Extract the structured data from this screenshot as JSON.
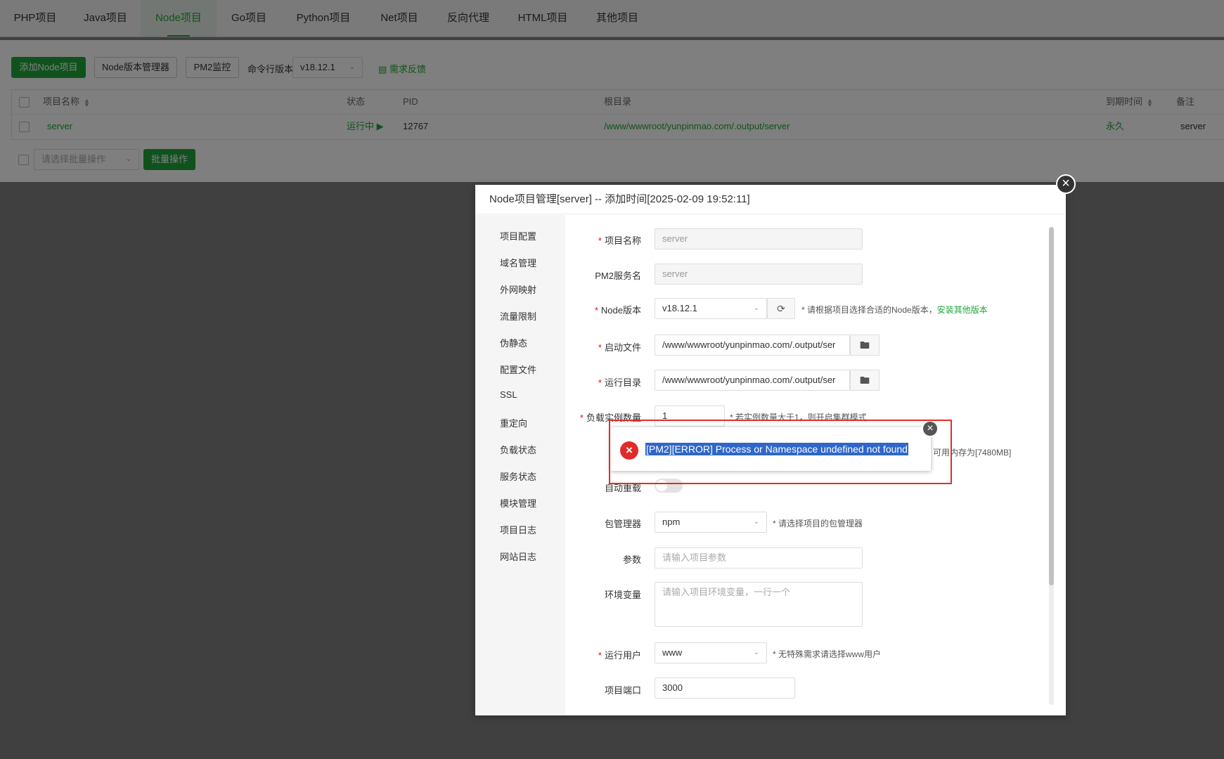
{
  "tabs": [
    "PHP项目",
    "Java项目",
    "Node项目",
    "Go项目",
    "Python项目",
    "Net项目",
    "反向代理",
    "HTML项目",
    "其他项目"
  ],
  "toolbar": {
    "add_label": "添加Node项目",
    "version_mgr_label": "Node版本管理器",
    "pm2_label": "PM2监控",
    "cli_version_label": "命令行版本",
    "cli_version_value": "v18.12.1",
    "feedback_label": "需求反馈"
  },
  "table": {
    "headers": {
      "name": "项目名称",
      "status": "状态",
      "pid": "PID",
      "root": "根目录",
      "expire": "到期时间",
      "note": "备注"
    },
    "row": {
      "name": "server",
      "status": "运行中 ▶",
      "pid": "12767",
      "root": "/www/wwwroot/yunpinmao.com/.output/server",
      "expire": "永久",
      "note": "server"
    }
  },
  "batch": {
    "placeholder": "请选择批量操作",
    "button": "批量操作"
  },
  "dialog": {
    "title": "Node项目管理[server] -- 添加时间[2025-02-09 19:52:11]",
    "sidebar": [
      "项目配置",
      "域名管理",
      "外网映射",
      "流量限制",
      "伪静态",
      "配置文件",
      "SSL",
      "重定向",
      "负载状态",
      "服务状态",
      "模块管理",
      "项目日志",
      "网站日志"
    ],
    "form": {
      "name_label": "项目名称",
      "name_value": "server",
      "pm2_label": "PM2服务名",
      "pm2_value": "server",
      "node_label": "Node版本",
      "node_value": "v18.12.1",
      "node_hint": "* 请根据项目选择合适的Node版本，",
      "node_link": "安装其他版本",
      "start_label": "启动文件",
      "start_value": "/www/wwwroot/yunpinmao.com/.output/ser",
      "rundir_label": "运行目录",
      "rundir_value": "/www/wwwroot/yunpinmao.com/.output/ser",
      "instances_label": "负载实例数量",
      "instances_value": "1",
      "instances_hint": "* 若实例数量大于1，则开启集群模式",
      "memory_hint": "可用内存为[7480MB]",
      "autoreload_label": "自动重载",
      "pkg_label": "包管理器",
      "pkg_value": "npm",
      "pkg_hint": "* 请选择项目的包管理器",
      "args_label": "参数",
      "args_placeholder": "请输入项目参数",
      "env_label": "环境变量",
      "env_placeholder": "请输入项目环境变量，一行一个",
      "user_label": "运行用户",
      "user_value": "www",
      "user_hint": "* 无特殊需求请选择www用户",
      "port_label": "项目端口",
      "port_value": "3000"
    }
  },
  "toast": {
    "message": "[PM2][ERROR] Process or Namespace undefined not found"
  },
  "colors": {
    "accent": "#20a53a",
    "error": "#e02b2b",
    "highlight_box": "#e52b2b",
    "selection": "#2f67c9"
  }
}
